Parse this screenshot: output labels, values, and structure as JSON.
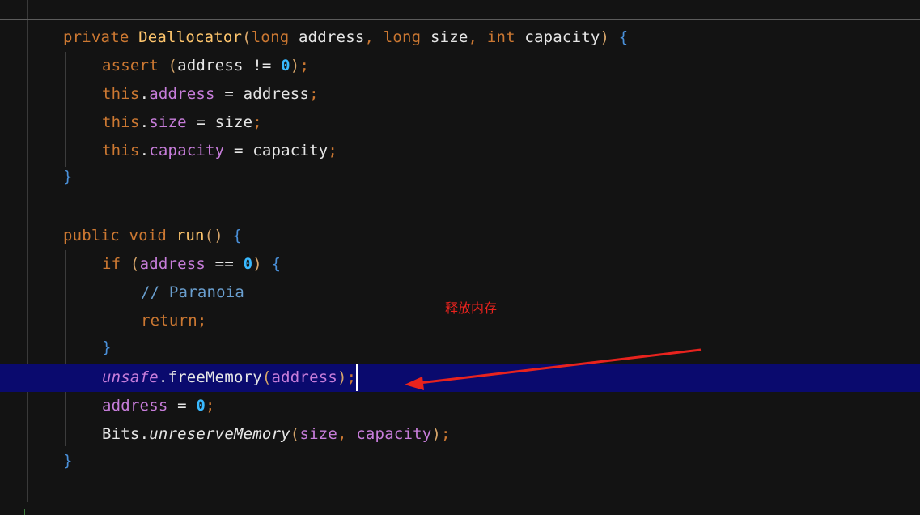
{
  "editor": {
    "colors": {
      "background": "#131313",
      "keyword": "#cc7832",
      "method": "#ffc66d",
      "field": "#c77dda",
      "number": "#39b9ff",
      "comment": "#6a9fcf",
      "highlight": "#0a0a6e",
      "annotation": "#e8231e"
    },
    "lines": [
      [
        {
          "t": "private",
          "c": "kw"
        },
        {
          "t": " ",
          "c": "plain"
        },
        {
          "t": "Deallocator",
          "c": "fn"
        },
        {
          "t": "(",
          "c": "paren"
        },
        {
          "t": "long",
          "c": "kw"
        },
        {
          "t": " address",
          "c": "plain"
        },
        {
          "t": ",",
          "c": "punc"
        },
        {
          "t": " ",
          "c": "plain"
        },
        {
          "t": "long",
          "c": "kw"
        },
        {
          "t": " size",
          "c": "plain"
        },
        {
          "t": ",",
          "c": "punc"
        },
        {
          "t": " ",
          "c": "plain"
        },
        {
          "t": "int",
          "c": "kw"
        },
        {
          "t": " capacity",
          "c": "plain"
        },
        {
          "t": ")",
          "c": "paren"
        },
        {
          "t": " ",
          "c": "plain"
        },
        {
          "t": "{",
          "c": "brace"
        }
      ],
      [
        {
          "t": "assert",
          "c": "kw"
        },
        {
          "t": " ",
          "c": "plain"
        },
        {
          "t": "(",
          "c": "paren"
        },
        {
          "t": "address != ",
          "c": "plain"
        },
        {
          "t": "0",
          "c": "num"
        },
        {
          "t": ")",
          "c": "paren"
        },
        {
          "t": ";",
          "c": "punc"
        }
      ],
      [
        {
          "t": "this",
          "c": "kw"
        },
        {
          "t": ".",
          "c": "plain"
        },
        {
          "t": "address",
          "c": "fld"
        },
        {
          "t": " = address",
          "c": "plain"
        },
        {
          "t": ";",
          "c": "punc"
        }
      ],
      [
        {
          "t": "this",
          "c": "kw"
        },
        {
          "t": ".",
          "c": "plain"
        },
        {
          "t": "size",
          "c": "fld"
        },
        {
          "t": " = size",
          "c": "plain"
        },
        {
          "t": ";",
          "c": "punc"
        }
      ],
      [
        {
          "t": "this",
          "c": "kw"
        },
        {
          "t": ".",
          "c": "plain"
        },
        {
          "t": "capacity",
          "c": "fld"
        },
        {
          "t": " = capacity",
          "c": "plain"
        },
        {
          "t": ";",
          "c": "punc"
        }
      ],
      [
        {
          "t": "}",
          "c": "brace"
        }
      ],
      [
        {
          "t": "public",
          "c": "kw"
        },
        {
          "t": " ",
          "c": "plain"
        },
        {
          "t": "void",
          "c": "kw"
        },
        {
          "t": " ",
          "c": "plain"
        },
        {
          "t": "run",
          "c": "fn"
        },
        {
          "t": "()",
          "c": "paren"
        },
        {
          "t": " ",
          "c": "plain"
        },
        {
          "t": "{",
          "c": "brace"
        }
      ],
      [
        {
          "t": "if",
          "c": "kw"
        },
        {
          "t": " ",
          "c": "plain"
        },
        {
          "t": "(",
          "c": "paren"
        },
        {
          "t": "address",
          "c": "fld"
        },
        {
          "t": " == ",
          "c": "plain"
        },
        {
          "t": "0",
          "c": "num"
        },
        {
          "t": ")",
          "c": "paren"
        },
        {
          "t": " ",
          "c": "plain"
        },
        {
          "t": "{",
          "c": "brace"
        }
      ],
      [
        {
          "t": "// Paranoia",
          "c": "cmt"
        }
      ],
      [
        {
          "t": "return",
          "c": "kw"
        },
        {
          "t": ";",
          "c": "punc"
        }
      ],
      [
        {
          "t": "}",
          "c": "brace"
        }
      ],
      [
        {
          "t": "unsafe",
          "c": "fld ital"
        },
        {
          "t": ".",
          "c": "plain"
        },
        {
          "t": "freeMemory",
          "c": "plain"
        },
        {
          "t": "(",
          "c": "paren"
        },
        {
          "t": "address",
          "c": "fld"
        },
        {
          "t": ")",
          "c": "paren"
        },
        {
          "t": ";",
          "c": "punc"
        }
      ],
      [
        {
          "t": "address",
          "c": "fld"
        },
        {
          "t": " = ",
          "c": "plain"
        },
        {
          "t": "0",
          "c": "num"
        },
        {
          "t": ";",
          "c": "punc"
        }
      ],
      [
        {
          "t": "Bits",
          "c": "plain"
        },
        {
          "t": ".",
          "c": "plain"
        },
        {
          "t": "unreserveMemory",
          "c": "plain ital"
        },
        {
          "t": "(",
          "c": "paren"
        },
        {
          "t": "size",
          "c": "fld"
        },
        {
          "t": ", ",
          "c": "punc"
        },
        {
          "t": "capacity",
          "c": "fld"
        },
        {
          "t": ")",
          "c": "paren"
        },
        {
          "t": ";",
          "c": "punc"
        }
      ],
      [
        {
          "t": "}",
          "c": "brace"
        }
      ]
    ]
  },
  "annotation": {
    "text": "释放内存"
  }
}
